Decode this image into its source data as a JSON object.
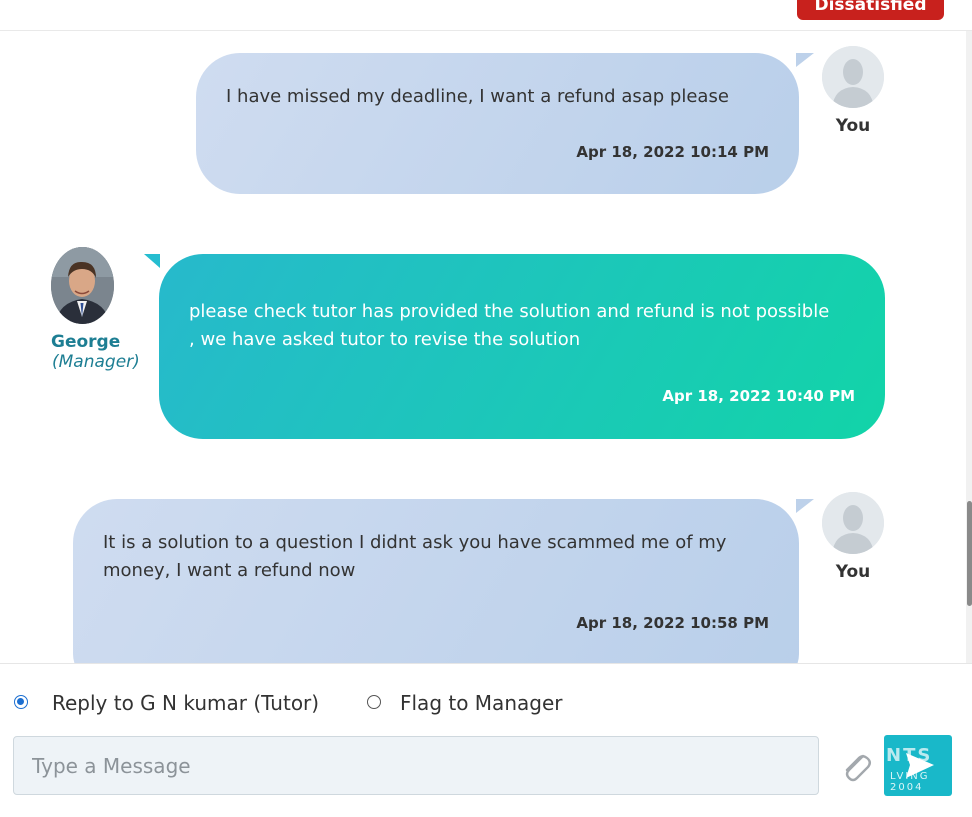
{
  "header": {
    "status_label": "Dissatisfied"
  },
  "messages": [
    {
      "direction": "outgoing",
      "text": "I have missed my deadline, I want a refund asap please",
      "time": "Apr 18, 2022 10:14 PM",
      "sender": "You"
    },
    {
      "direction": "incoming",
      "text": "please check tutor has provided the solution and refund is not possible , we have asked tutor to revise the solution",
      "time": "Apr 18, 2022 10:40 PM",
      "sender": "George",
      "role": "(Manager)"
    },
    {
      "direction": "outgoing",
      "text": "It is a solution to a question I didnt ask you have scammed me of my money, I want a refund now",
      "time": "Apr 18, 2022 10:58 PM",
      "sender": "You"
    }
  ],
  "composer": {
    "reply_option": "Reply to G N kumar (Tutor)",
    "flag_option": "Flag to Manager",
    "selected": "reply",
    "placeholder": "Type a Message",
    "value": "",
    "attach_icon": "paperclip-icon",
    "send_icon": "send-arrow-icon"
  },
  "watermark": {
    "text_top": "NTS",
    "text_mid": "LVING",
    "text_bottom": "2004"
  },
  "colors": {
    "status_red": "#c8211d",
    "incoming_start": "#27b9cc",
    "incoming_end": "#12d4a8",
    "outgoing": "#c3d5ec",
    "agent_name": "#1d7e93",
    "send_button": "#19b8c9",
    "radio_selected": "#1c6fd1"
  }
}
